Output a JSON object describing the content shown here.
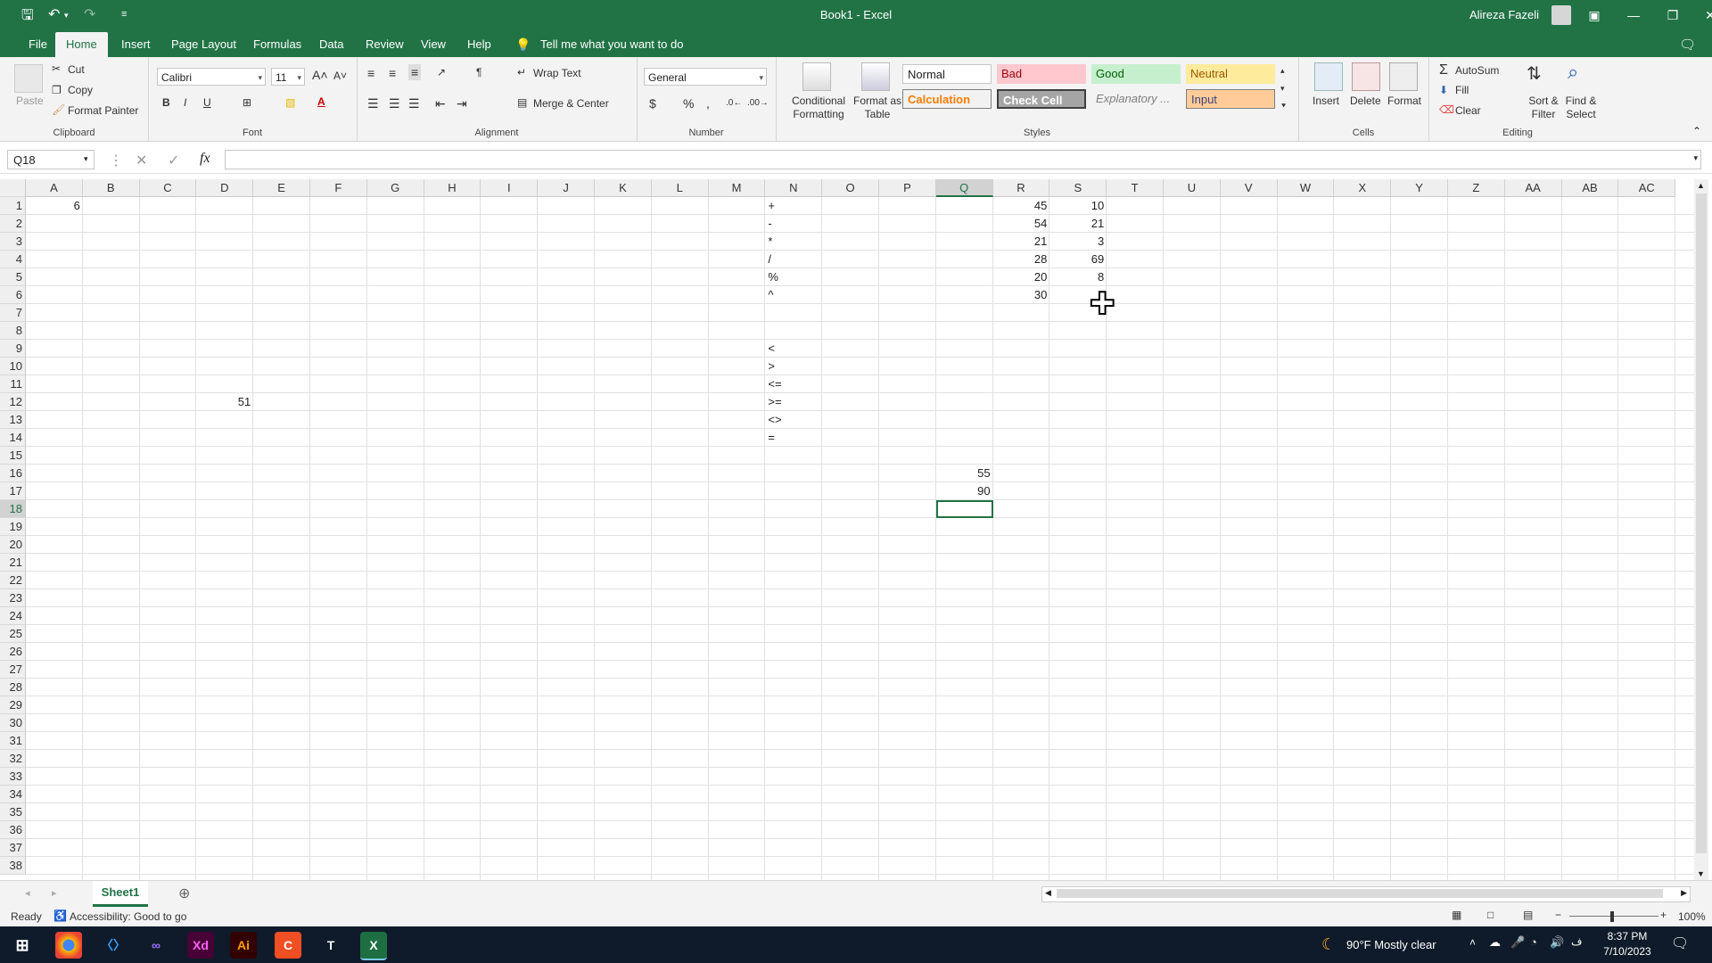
{
  "titlebar": {
    "title": "Book1  -  Excel",
    "user": "Alireza Fazeli"
  },
  "tabs": [
    "File",
    "Home",
    "Insert",
    "Page Layout",
    "Formulas",
    "Data",
    "Review",
    "View",
    "Help"
  ],
  "tell_me": "Tell me what you want to do",
  "ribbon": {
    "clipboard": {
      "paste": "Paste",
      "cut": "Cut",
      "copy": "Copy",
      "format_painter": "Format Painter",
      "label": "Clipboard"
    },
    "font": {
      "name": "Calibri",
      "size": "11",
      "label": "Font"
    },
    "alignment": {
      "wrap": "Wrap Text",
      "merge": "Merge & Center",
      "label": "Alignment"
    },
    "number": {
      "format": "General",
      "label": "Number"
    },
    "styles": {
      "conditional": "Conditional Formatting",
      "format_table": "Format as Table",
      "normal": "Normal",
      "bad": "Bad",
      "good": "Good",
      "neutral": "Neutral",
      "calculation": "Calculation",
      "check_cell": "Check Cell",
      "explanatory": "Explanatory ...",
      "input": "Input",
      "label": "Styles"
    },
    "cells": {
      "insert": "Insert",
      "delete": "Delete",
      "format": "Format",
      "label": "Cells"
    },
    "editing": {
      "autosum": "AutoSum",
      "fill": "Fill",
      "clear": "Clear",
      "sort": "Sort & Filter",
      "find": "Find & Select",
      "label": "Editing"
    }
  },
  "formula_bar": {
    "namebox": "Q18",
    "formula": ""
  },
  "columns": [
    "A",
    "B",
    "C",
    "D",
    "E",
    "F",
    "G",
    "H",
    "I",
    "J",
    "K",
    "L",
    "M",
    "N",
    "O",
    "P",
    "Q",
    "R",
    "S",
    "T",
    "U",
    "V",
    "W",
    "X",
    "Y",
    "Z",
    "AA",
    "AB",
    "AC"
  ],
  "rows": [
    "1",
    "2",
    "3",
    "4",
    "5",
    "6",
    "7",
    "8",
    "9",
    "10",
    "11",
    "12",
    "13",
    "14",
    "15",
    "16",
    "17",
    "18",
    "19",
    "20",
    "21",
    "22",
    "23",
    "24",
    "25",
    "26",
    "27",
    "28",
    "29",
    "30",
    "31",
    "32",
    "33",
    "34",
    "35",
    "36",
    "37",
    "38"
  ],
  "cells": [
    {
      "ref": "A1",
      "value": "6",
      "col": 0,
      "row": 0,
      "type": "num"
    },
    {
      "ref": "D12",
      "value": "51",
      "col": 3,
      "row": 11,
      "type": "num"
    },
    {
      "ref": "N1",
      "value": "+",
      "col": 13,
      "row": 0,
      "type": "text"
    },
    {
      "ref": "N2",
      "value": "-",
      "col": 13,
      "row": 1,
      "type": "text"
    },
    {
      "ref": "N3",
      "value": "*",
      "col": 13,
      "row": 2,
      "type": "text"
    },
    {
      "ref": "N4",
      "value": "/",
      "col": 13,
      "row": 3,
      "type": "text"
    },
    {
      "ref": "N5",
      "value": "%",
      "col": 13,
      "row": 4,
      "type": "text"
    },
    {
      "ref": "N6",
      "value": "^",
      "col": 13,
      "row": 5,
      "type": "text"
    },
    {
      "ref": "N9",
      "value": "<",
      "col": 13,
      "row": 8,
      "type": "text"
    },
    {
      "ref": "N10",
      "value": ">",
      "col": 13,
      "row": 9,
      "type": "text"
    },
    {
      "ref": "N11",
      "value": "<=",
      "col": 13,
      "row": 10,
      "type": "text"
    },
    {
      "ref": "N12",
      "value": ">=",
      "col": 13,
      "row": 11,
      "type": "text"
    },
    {
      "ref": "N13",
      "value": "<>",
      "col": 13,
      "row": 12,
      "type": "text"
    },
    {
      "ref": "N14",
      "value": "=",
      "col": 13,
      "row": 13,
      "type": "text"
    },
    {
      "ref": "R1",
      "value": "45",
      "col": 17,
      "row": 0,
      "type": "num"
    },
    {
      "ref": "R2",
      "value": "54",
      "col": 17,
      "row": 1,
      "type": "num"
    },
    {
      "ref": "R3",
      "value": "21",
      "col": 17,
      "row": 2,
      "type": "num"
    },
    {
      "ref": "R4",
      "value": "28",
      "col": 17,
      "row": 3,
      "type": "num"
    },
    {
      "ref": "R5",
      "value": "20",
      "col": 17,
      "row": 4,
      "type": "num"
    },
    {
      "ref": "R6",
      "value": "30",
      "col": 17,
      "row": 5,
      "type": "num"
    },
    {
      "ref": "S1",
      "value": "10",
      "col": 18,
      "row": 0,
      "type": "num"
    },
    {
      "ref": "S2",
      "value": "21",
      "col": 18,
      "row": 1,
      "type": "num"
    },
    {
      "ref": "S3",
      "value": "3",
      "col": 18,
      "row": 2,
      "type": "num"
    },
    {
      "ref": "S4",
      "value": "69",
      "col": 18,
      "row": 3,
      "type": "num"
    },
    {
      "ref": "S5",
      "value": "8",
      "col": 18,
      "row": 4,
      "type": "num"
    },
    {
      "ref": "Q16",
      "value": "55",
      "col": 16,
      "row": 15,
      "type": "num"
    },
    {
      "ref": "Q17",
      "value": "90",
      "col": 16,
      "row": 16,
      "type": "num"
    }
  ],
  "sheet_tab": "Sheet1",
  "status": {
    "ready": "Ready",
    "accessibility": "Accessibility: Good to go",
    "zoom": "100%"
  },
  "taskbar": {
    "weather": "90°F  Mostly clear",
    "time": "8:37 PM",
    "date": "7/10/2023"
  }
}
